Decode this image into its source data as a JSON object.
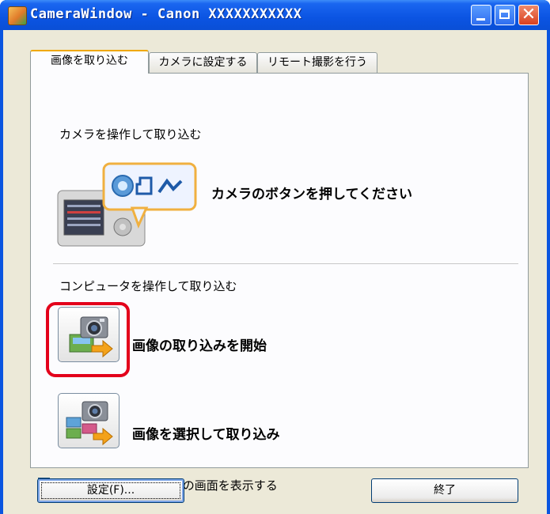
{
  "window": {
    "title": "CameraWindow - Canon XXXXXXXXXXX",
    "accent_color": "#0a55e0",
    "icons": [
      "app-icon",
      "minimize-icon",
      "maximize-icon",
      "close-icon"
    ]
  },
  "tabs": [
    {
      "label": "画像を取り込む",
      "active": true
    },
    {
      "label": "カメラに設定する",
      "active": false
    },
    {
      "label": "リモート撮影を行う",
      "active": false
    }
  ],
  "camera_section": {
    "heading": "カメラを操作して取り込む",
    "instruction": "カメラのボタンを押してください"
  },
  "computer_section": {
    "heading": "コンピュータを操作して取り込む",
    "start_import_label": "画像の取り込みを開始",
    "select_import_label": "画像を選択して取り込み",
    "highlight_color": "#e3001b"
  },
  "footer": {
    "show_on_connect_label": "カメラを接続した時にこの画面を表示する",
    "show_on_connect_checked": true,
    "settings_label": "設定(F)...",
    "exit_label": "終了"
  }
}
